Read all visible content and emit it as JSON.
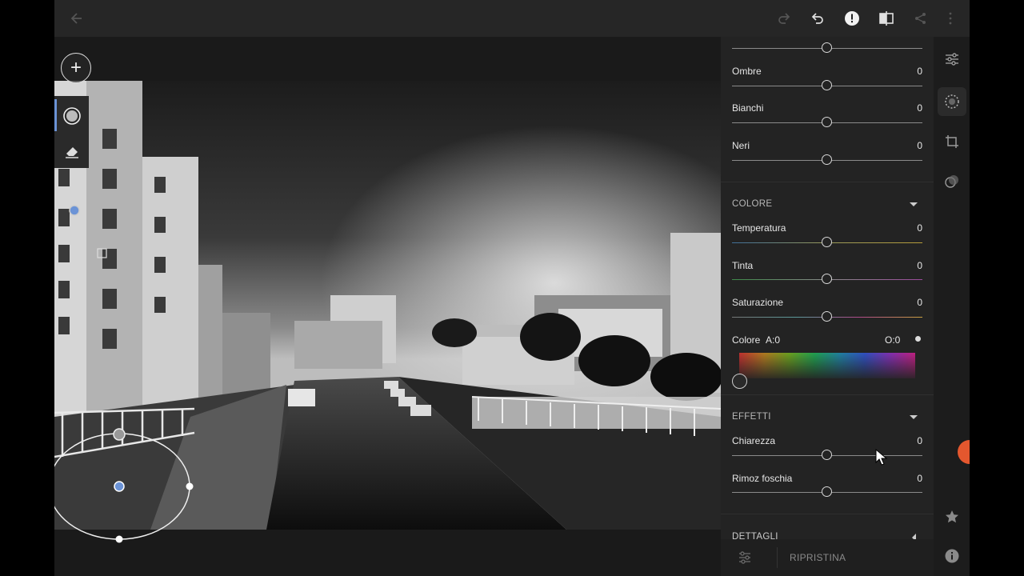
{
  "panel": {
    "sliders_top": [
      {
        "label": "",
        "value": ""
      },
      {
        "label": "Ombre",
        "value": "0"
      },
      {
        "label": "Bianchi",
        "value": "0"
      },
      {
        "label": "Neri",
        "value": "0"
      }
    ],
    "colore_section": "COLORE",
    "colore_sliders": [
      {
        "label": "Temperatura",
        "value": "0"
      },
      {
        "label": "Tinta",
        "value": "0"
      },
      {
        "label": "Saturazione",
        "value": "0"
      }
    ],
    "colore_picker": {
      "label": "Colore",
      "a": "A:0",
      "o": "O:0"
    },
    "effetti_section": "EFFETTI",
    "effetti_sliders": [
      {
        "label": "Chiarezza",
        "value": "0"
      },
      {
        "label": "Rimoz foschia",
        "value": "0"
      }
    ],
    "dettagli_section": "DETTAGLI",
    "reset_label": "RIPRISTINA"
  },
  "icons": {
    "top": [
      "back-arrow-icon",
      "redo-icon",
      "undo-icon",
      "alert-icon",
      "compare-icon",
      "share-icon",
      "more-icon"
    ],
    "rail": [
      "adjustments-icon",
      "selective-icon",
      "crop-icon",
      "presets-icon",
      "star-icon",
      "info-icon"
    ],
    "tools": [
      "add-icon",
      "brush-circle-icon",
      "eraser-icon"
    ]
  },
  "colors": {
    "accent": "#6b93d6",
    "bg": "#1e1e1e",
    "panel": "#232323"
  }
}
